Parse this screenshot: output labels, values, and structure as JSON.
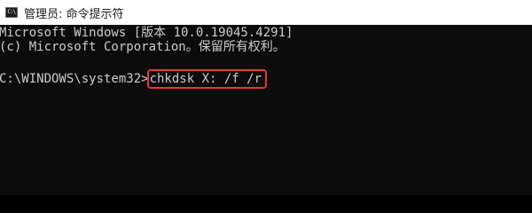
{
  "titlebar": {
    "icon_text": "C:\\",
    "title": "管理员: 命令提示符"
  },
  "console": {
    "line1": "Microsoft Windows [版本 10.0.19045.4291]",
    "line2": "(c) Microsoft Corporation。保留所有权利。",
    "prompt": "C:\\WINDOWS\\system32>",
    "command": "chkdsk X: /f /r"
  },
  "colors": {
    "background": "#0c0c0c",
    "text": "#cccccc",
    "highlight_border": "#e53935",
    "titlebar": "#ffffff"
  },
  "icons": {
    "app": "cmd-app-icon"
  }
}
